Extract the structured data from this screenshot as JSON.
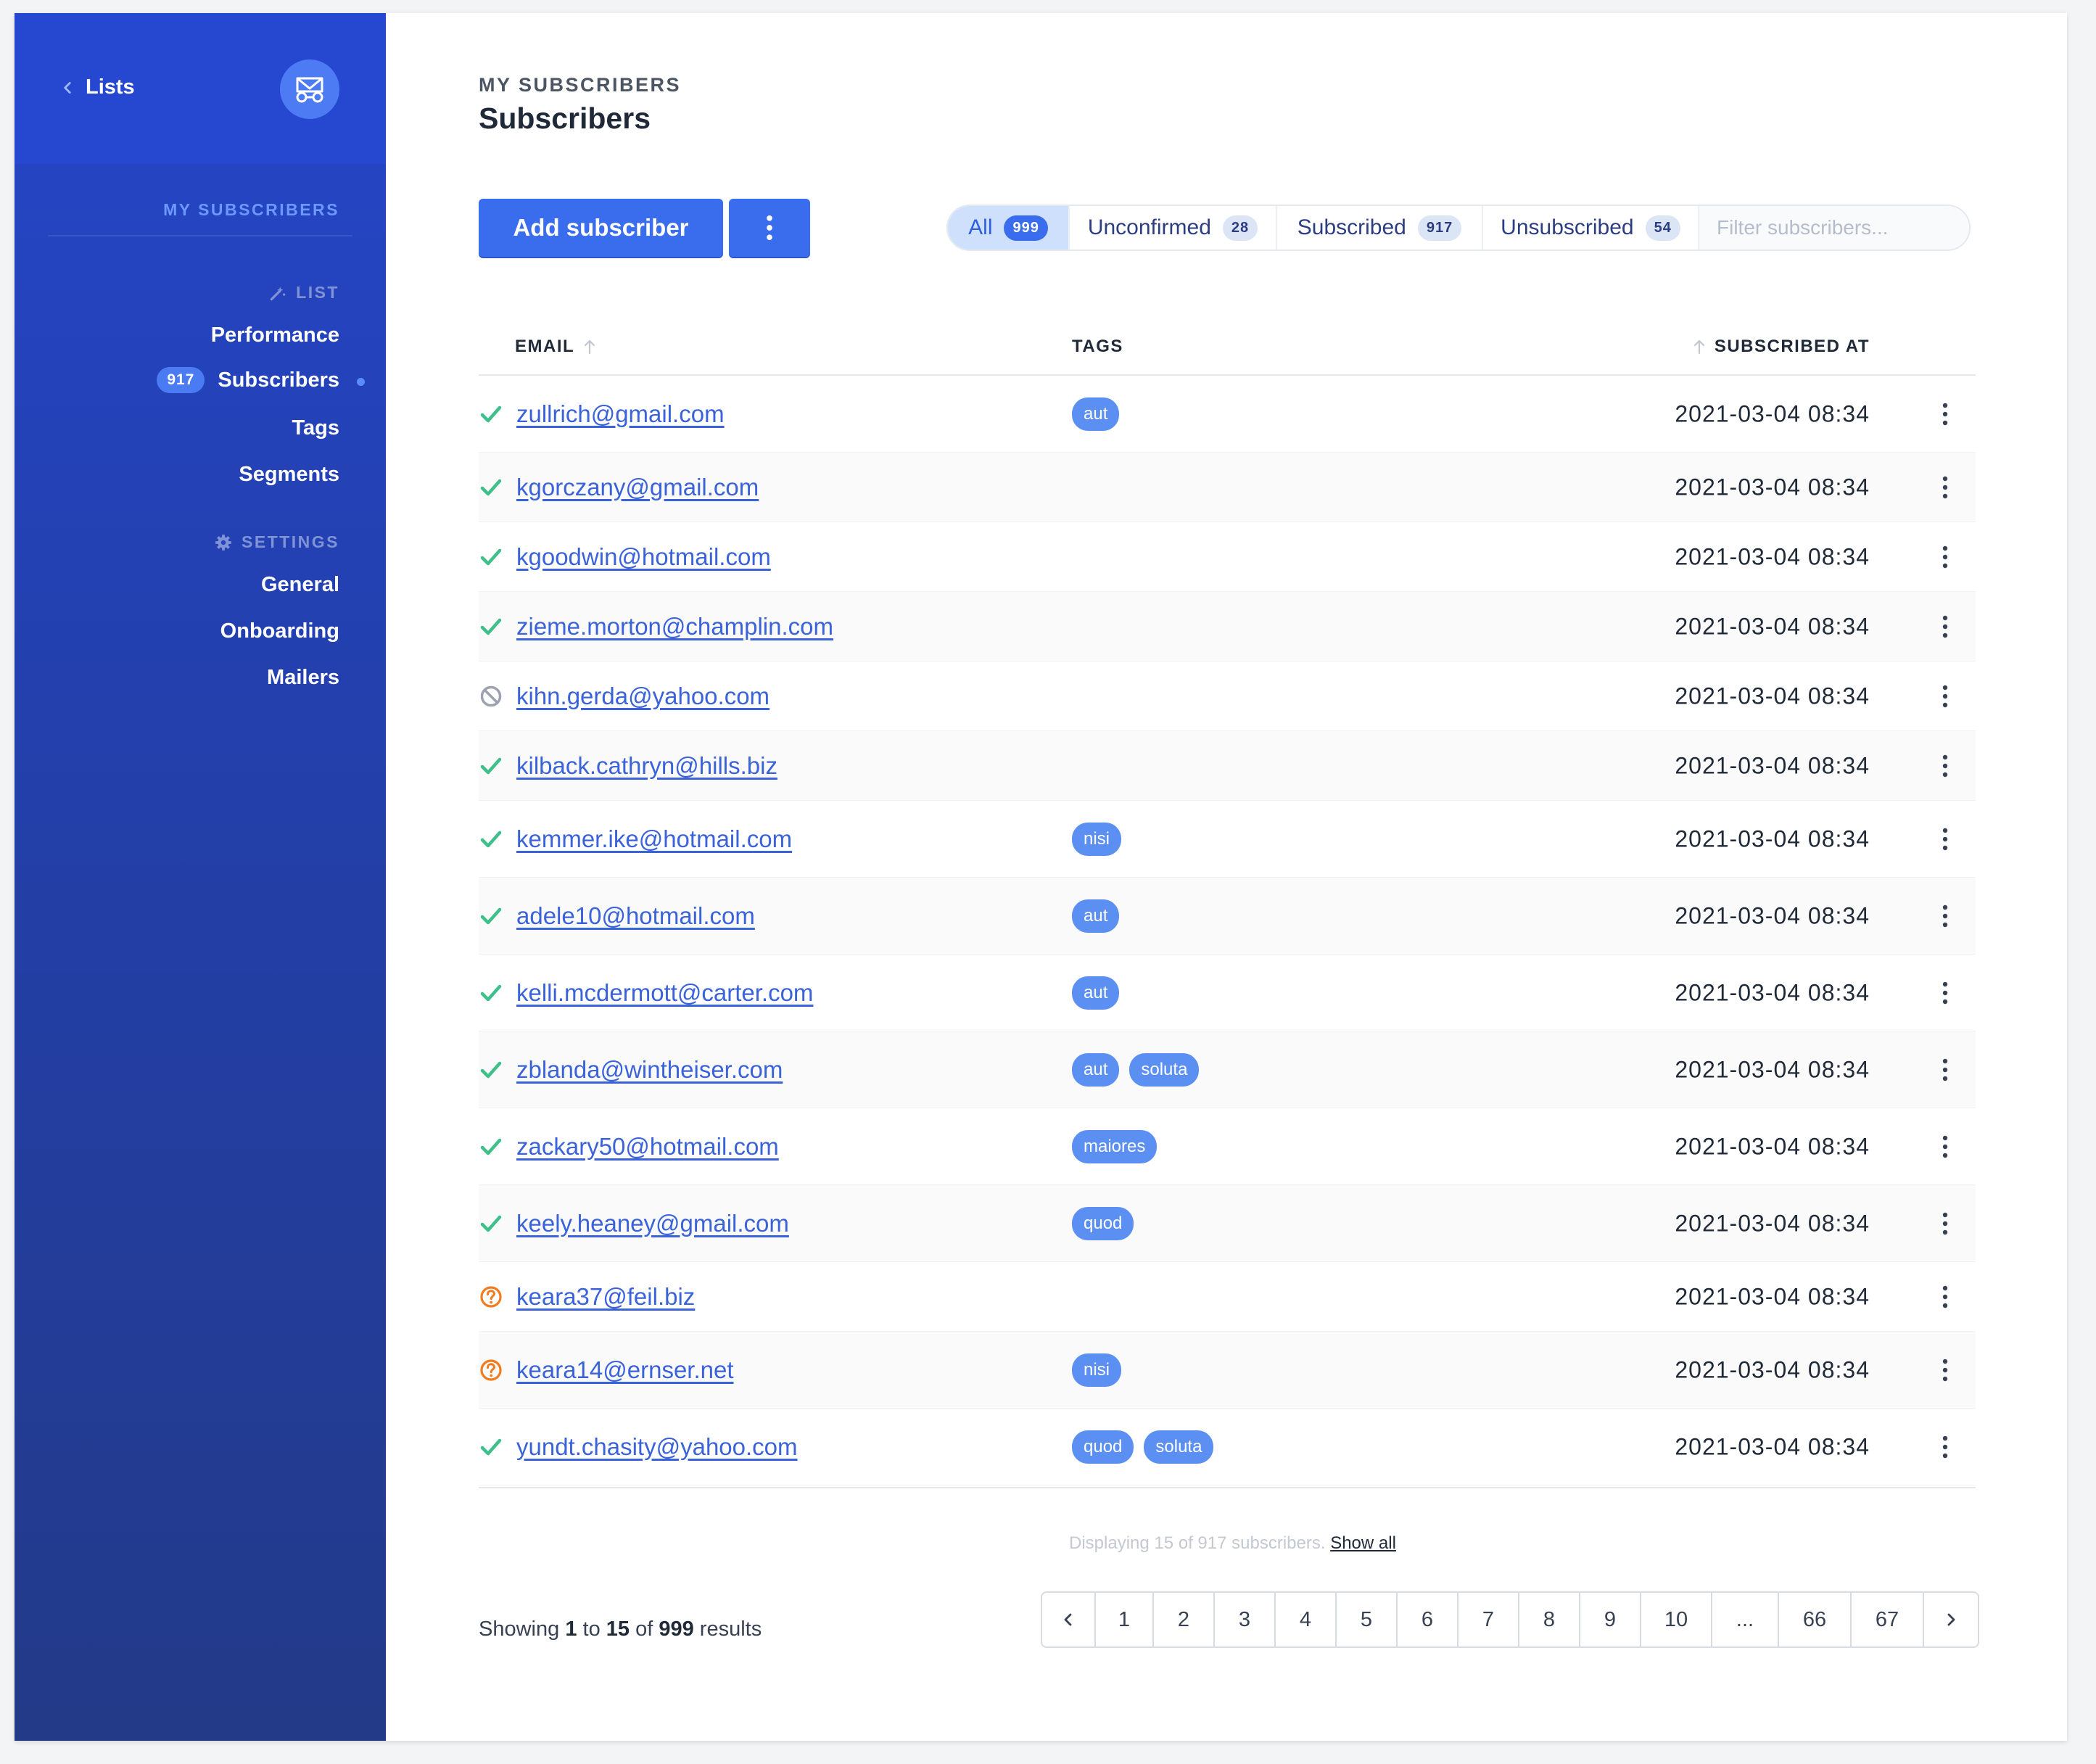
{
  "sidebar": {
    "back_label": "Lists",
    "section_title": "My Subscribers",
    "list_heading": "List",
    "settings_heading": "Settings",
    "items": {
      "performance": "Performance",
      "subscribers": "Subscribers",
      "subscribers_count": "917",
      "tags": "Tags",
      "segments": "Segments",
      "general": "General",
      "onboarding": "Onboarding",
      "mailers": "Mailers"
    }
  },
  "header": {
    "breadcrumb": "My Subscribers",
    "title": "Subscribers"
  },
  "toolbar": {
    "add_label": "Add subscriber",
    "filters": [
      {
        "label": "All",
        "count": "999",
        "active": true
      },
      {
        "label": "Unconfirmed",
        "count": "28",
        "active": false
      },
      {
        "label": "Subscribed",
        "count": "917",
        "active": false
      },
      {
        "label": "Unsubscribed",
        "count": "54",
        "active": false
      }
    ],
    "search_placeholder": "Filter subscribers..."
  },
  "table": {
    "columns": {
      "email": "EMAIL",
      "tags": "TAGS",
      "subscribed_at": "SUBSCRIBED AT"
    },
    "rows": [
      {
        "status": "subscribed",
        "email": "zullrich@gmail.com",
        "tags": [
          "aut"
        ],
        "date": "2021-03-04 08:34"
      },
      {
        "status": "subscribed",
        "email": "kgorczany@gmail.com",
        "tags": [],
        "date": "2021-03-04 08:34"
      },
      {
        "status": "subscribed",
        "email": "kgoodwin@hotmail.com",
        "tags": [],
        "date": "2021-03-04 08:34"
      },
      {
        "status": "subscribed",
        "email": "zieme.morton@champlin.com",
        "tags": [],
        "date": "2021-03-04 08:34"
      },
      {
        "status": "unsubscribed",
        "email": "kihn.gerda@yahoo.com",
        "tags": [],
        "date": "2021-03-04 08:34"
      },
      {
        "status": "subscribed",
        "email": "kilback.cathryn@hills.biz",
        "tags": [],
        "date": "2021-03-04 08:34"
      },
      {
        "status": "subscribed",
        "email": "kemmer.ike@hotmail.com",
        "tags": [
          "nisi"
        ],
        "date": "2021-03-04 08:34"
      },
      {
        "status": "subscribed",
        "email": "adele10@hotmail.com",
        "tags": [
          "aut"
        ],
        "date": "2021-03-04 08:34"
      },
      {
        "status": "subscribed",
        "email": "kelli.mcdermott@carter.com",
        "tags": [
          "aut"
        ],
        "date": "2021-03-04 08:34"
      },
      {
        "status": "subscribed",
        "email": "zblanda@wintheiser.com",
        "tags": [
          "aut",
          "soluta"
        ],
        "date": "2021-03-04 08:34"
      },
      {
        "status": "subscribed",
        "email": "zackary50@hotmail.com",
        "tags": [
          "maiores"
        ],
        "date": "2021-03-04 08:34"
      },
      {
        "status": "subscribed",
        "email": "keely.heaney@gmail.com",
        "tags": [
          "quod"
        ],
        "date": "2021-03-04 08:34"
      },
      {
        "status": "unconfirmed",
        "email": "keara37@feil.biz",
        "tags": [],
        "date": "2021-03-04 08:34"
      },
      {
        "status": "unconfirmed",
        "email": "keara14@ernser.net",
        "tags": [
          "nisi"
        ],
        "date": "2021-03-04 08:34"
      },
      {
        "status": "subscribed",
        "email": "yundt.chasity@yahoo.com",
        "tags": [
          "quod",
          "soluta"
        ],
        "date": "2021-03-04 08:34"
      }
    ]
  },
  "footer": {
    "display_note": "Displaying 15 of 917 subscribers.",
    "show_all": "Show all",
    "showing": {
      "prefix": "Showing",
      "from": "1",
      "to_word": "to",
      "to": "15",
      "of_word": "of",
      "total": "999",
      "suffix": "results"
    },
    "pages": [
      "1",
      "2",
      "3",
      "4",
      "5",
      "6",
      "7",
      "8",
      "9",
      "10",
      "...",
      "66",
      "67"
    ]
  },
  "colors": {
    "accent": "#3a6ded",
    "sidebar": "#2545c8",
    "subscribed": "#3fbf8a",
    "unconfirmed": "#f07c1f",
    "unsubscribed": "#9ca3af",
    "tag": "#5b8ff2"
  }
}
